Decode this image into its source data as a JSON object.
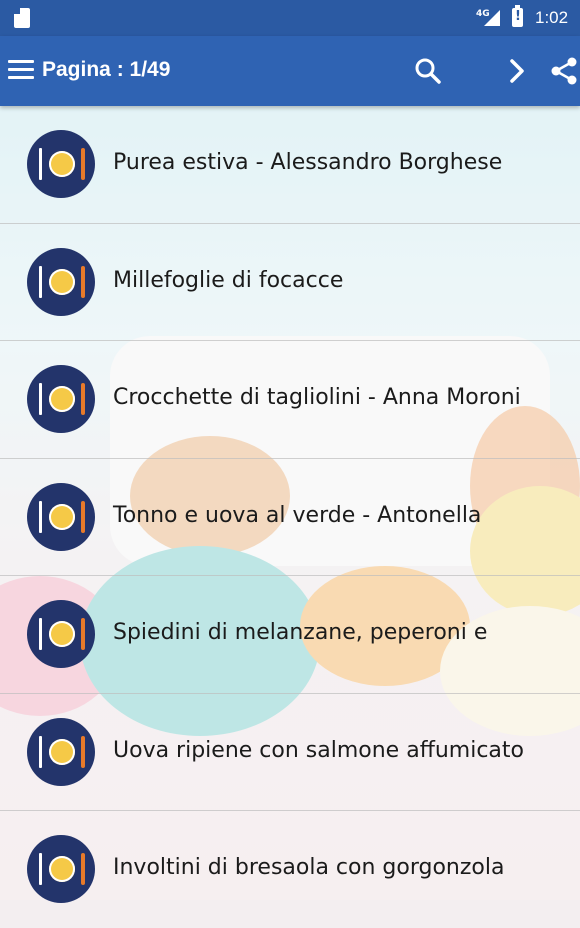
{
  "status_bar": {
    "network": "4G",
    "time": "1:02"
  },
  "toolbar": {
    "title": "Pagina : 1/49"
  },
  "recipes": [
    {
      "label": "Purea estiva - Alessandro Borghese"
    },
    {
      "label": "Millefoglie di focacce"
    },
    {
      "label": "Crocchette di tagliolini - Anna Moroni"
    },
    {
      "label": "Tonno e uova al verde - Antonella"
    },
    {
      "label": "Spiedini di melanzane, peperoni e"
    },
    {
      "label": "Uova ripiene con salmone affumicato"
    },
    {
      "label": "Involtini di bresaola con gorgonzola"
    }
  ]
}
